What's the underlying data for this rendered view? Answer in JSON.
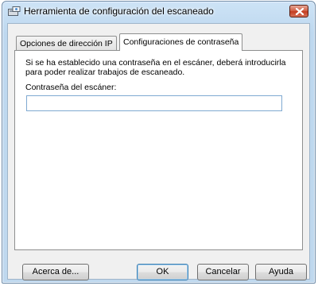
{
  "window": {
    "title": "Herramienta de configuración del escaneado",
    "icon": "scanner-tool-icon",
    "close_icon": "close-icon"
  },
  "tabs": [
    {
      "label": "Opciones de dirección IP",
      "selected": false
    },
    {
      "label": "Configuraciones de contraseña",
      "selected": true
    }
  ],
  "panel": {
    "description": "Si se ha establecido una contraseña en el escáner, deberá introducirla para poder realizar trabajos de escaneado.",
    "password_label": "Contraseña del escáner:",
    "password_value": ""
  },
  "buttons": {
    "about": "Acerca de...",
    "ok": "OK",
    "cancel": "Cancelar",
    "help": "Ayuda"
  },
  "colors": {
    "frame": "#bfd8ee",
    "close_button": "#c43c20",
    "input_border": "#7fa9d1"
  }
}
